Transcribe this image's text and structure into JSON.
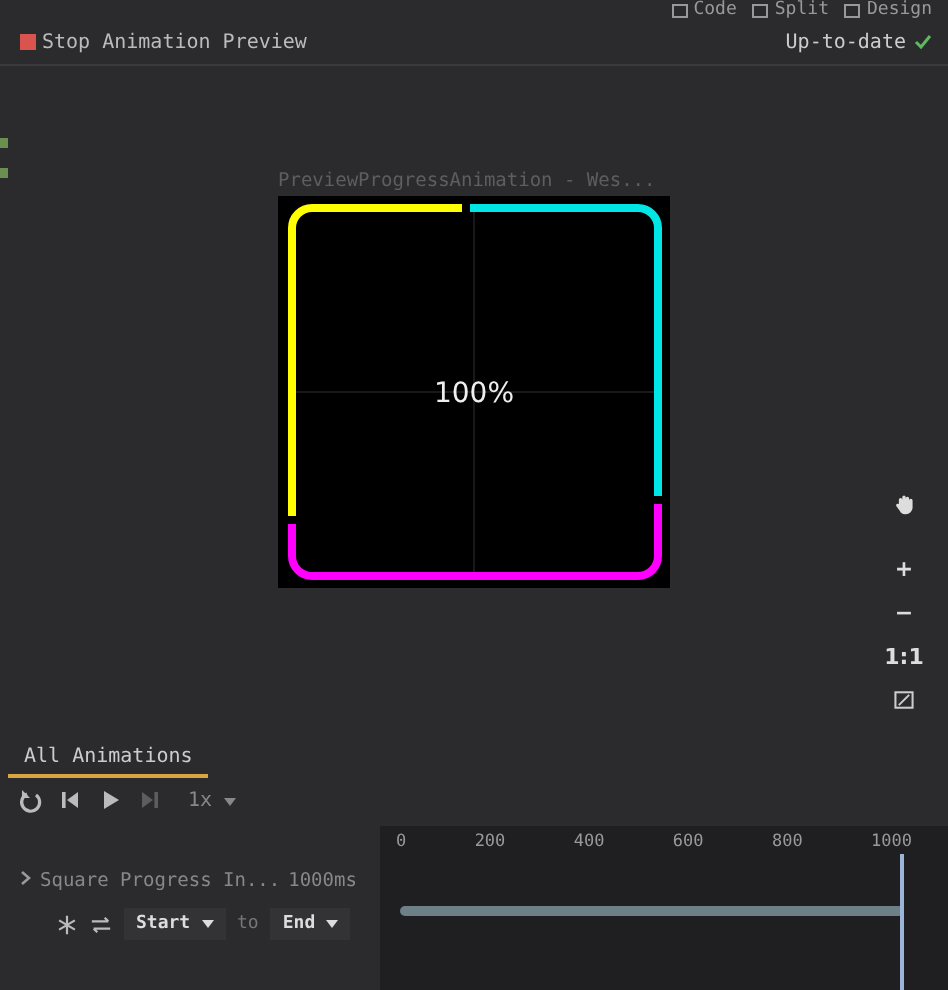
{
  "view_modes": [
    {
      "label": "Code",
      "selected": false
    },
    {
      "label": "Split",
      "selected": false
    },
    {
      "label": "Design",
      "selected": false
    }
  ],
  "toolbar": {
    "stop_label": "Stop Animation Preview",
    "status": "Up-to-date"
  },
  "preview": {
    "title": "PreviewProgressAnimation - Wes...",
    "center_text": "100%"
  },
  "zoom_controls": [
    {
      "kind": "icon"
    },
    {
      "kind": "text",
      "label": "+"
    },
    {
      "kind": "text",
      "label": "−"
    },
    {
      "kind": "text",
      "label": "1:1"
    },
    {
      "kind": "icon"
    }
  ],
  "tabs": [
    {
      "label": "All Animations",
      "selected": true
    }
  ],
  "playback": {
    "buttons": [
      {
        "disabled": false
      },
      {
        "disabled": false
      },
      {
        "disabled": false
      },
      {
        "disabled": true
      }
    ],
    "speed": "1x"
  },
  "animations": [
    {
      "name": "Square Progress In...",
      "duration": "1000ms",
      "expanded": false,
      "from": "Start",
      "connector": "to",
      "to": "End"
    }
  ],
  "timeline": {
    "ticks": [
      "0",
      "200",
      "400",
      "600",
      "800",
      "1000"
    ],
    "playhead": {
      "level": 1
    }
  }
}
